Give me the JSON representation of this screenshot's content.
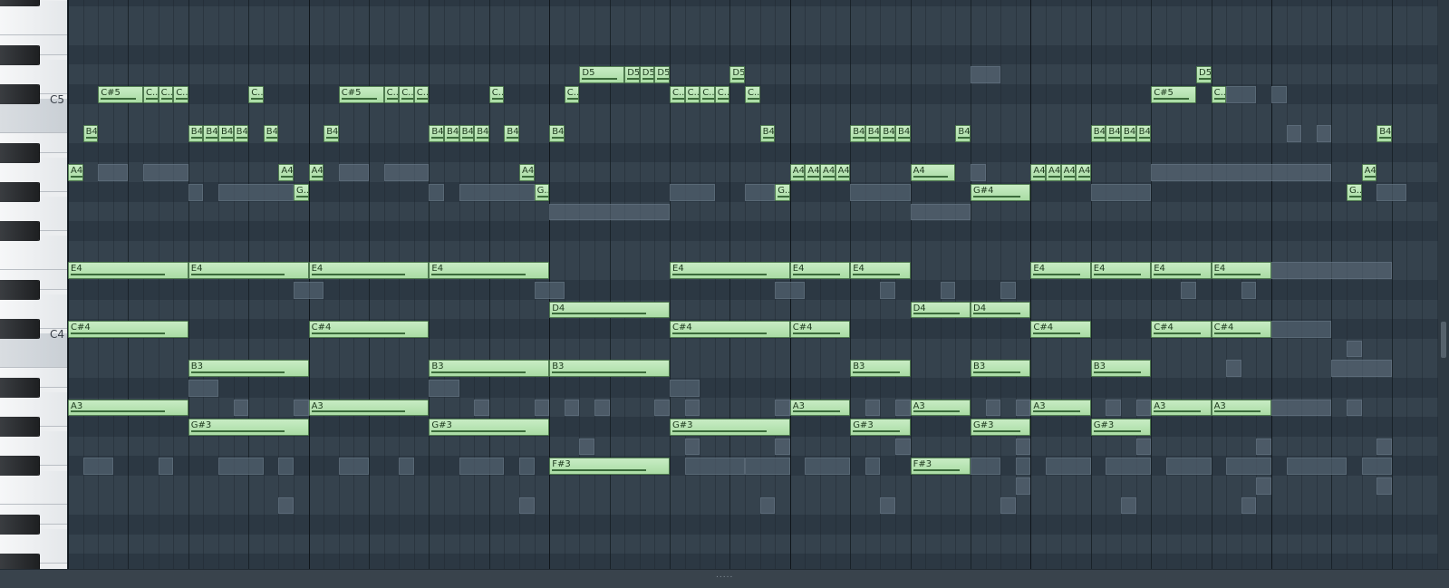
{
  "keyboard": {
    "c5_label": "C5",
    "c4_label": "C4"
  },
  "roll": {
    "lowest_pitch": "F#3",
    "highest_pitch": "E5",
    "steps_visible": 92,
    "steps_per_beat": 4,
    "steps_per_bar": 16
  },
  "notes": [
    {
      "label": "A4",
      "pitch": "A4",
      "start": 0,
      "length": 1
    },
    {
      "label": "B4",
      "pitch": "B4",
      "start": 1,
      "length": 1
    },
    {
      "label": "C#5",
      "pitch": "C#5",
      "start": 2,
      "length": 3
    },
    {
      "label": "C..",
      "pitch": "C#5",
      "start": 5,
      "length": 1
    },
    {
      "label": "C..",
      "pitch": "C#5",
      "start": 6,
      "length": 1
    },
    {
      "label": "C..",
      "pitch": "C#5",
      "start": 7,
      "length": 1
    },
    {
      "label": "B4",
      "pitch": "B4",
      "start": 8,
      "length": 1
    },
    {
      "label": "B4",
      "pitch": "B4",
      "start": 9,
      "length": 1
    },
    {
      "label": "B4",
      "pitch": "B4",
      "start": 10,
      "length": 1
    },
    {
      "label": "B4",
      "pitch": "B4",
      "start": 11,
      "length": 1
    },
    {
      "label": "C..",
      "pitch": "C#5",
      "start": 12,
      "length": 1
    },
    {
      "label": "B4",
      "pitch": "B4",
      "start": 13,
      "length": 1
    },
    {
      "label": "A4",
      "pitch": "A4",
      "start": 14,
      "length": 1
    },
    {
      "label": "G..",
      "pitch": "G#4",
      "start": 15,
      "length": 1
    },
    {
      "label": "A4",
      "pitch": "A4",
      "start": 16,
      "length": 1
    },
    {
      "label": "B4",
      "pitch": "B4",
      "start": 17,
      "length": 1
    },
    {
      "label": "C#5",
      "pitch": "C#5",
      "start": 18,
      "length": 3
    },
    {
      "label": "C..",
      "pitch": "C#5",
      "start": 21,
      "length": 1
    },
    {
      "label": "C..",
      "pitch": "C#5",
      "start": 22,
      "length": 1
    },
    {
      "label": "C..",
      "pitch": "C#5",
      "start": 23,
      "length": 1
    },
    {
      "label": "B4",
      "pitch": "B4",
      "start": 24,
      "length": 1
    },
    {
      "label": "B4",
      "pitch": "B4",
      "start": 25,
      "length": 1
    },
    {
      "label": "B4",
      "pitch": "B4",
      "start": 26,
      "length": 1
    },
    {
      "label": "B4",
      "pitch": "B4",
      "start": 27,
      "length": 1
    },
    {
      "label": "C..",
      "pitch": "C#5",
      "start": 28,
      "length": 1
    },
    {
      "label": "B4",
      "pitch": "B4",
      "start": 29,
      "length": 1
    },
    {
      "label": "A4",
      "pitch": "A4",
      "start": 30,
      "length": 1
    },
    {
      "label": "G..",
      "pitch": "G#4",
      "start": 31,
      "length": 1
    },
    {
      "label": "B4",
      "pitch": "B4",
      "start": 32,
      "length": 1
    },
    {
      "label": "C..",
      "pitch": "C#5",
      "start": 33,
      "length": 1
    },
    {
      "label": "D5",
      "pitch": "D5",
      "start": 34,
      "length": 3
    },
    {
      "label": "D5",
      "pitch": "D5",
      "start": 37,
      "length": 1
    },
    {
      "label": "D5",
      "pitch": "D5",
      "start": 38,
      "length": 1
    },
    {
      "label": "D5",
      "pitch": "D5",
      "start": 39,
      "length": 1
    },
    {
      "label": "C..",
      "pitch": "C#5",
      "start": 40,
      "length": 1
    },
    {
      "label": "C..",
      "pitch": "C#5",
      "start": 41,
      "length": 1
    },
    {
      "label": "C..",
      "pitch": "C#5",
      "start": 42,
      "length": 1
    },
    {
      "label": "C..",
      "pitch": "C#5",
      "start": 43,
      "length": 1
    },
    {
      "label": "D5",
      "pitch": "D5",
      "start": 44,
      "length": 1
    },
    {
      "label": "C..",
      "pitch": "C#5",
      "start": 45,
      "length": 1
    },
    {
      "label": "B4",
      "pitch": "B4",
      "start": 46,
      "length": 1
    },
    {
      "label": "G..",
      "pitch": "G#4",
      "start": 47,
      "length": 1
    },
    {
      "label": "A4",
      "pitch": "A4",
      "start": 48,
      "length": 1
    },
    {
      "label": "A4",
      "pitch": "A4",
      "start": 49,
      "length": 1
    },
    {
      "label": "A4",
      "pitch": "A4",
      "start": 50,
      "length": 1
    },
    {
      "label": "A4",
      "pitch": "A4",
      "start": 51,
      "length": 1
    },
    {
      "label": "B4",
      "pitch": "B4",
      "start": 52,
      "length": 1
    },
    {
      "label": "B4",
      "pitch": "B4",
      "start": 53,
      "length": 1
    },
    {
      "label": "B4",
      "pitch": "B4",
      "start": 54,
      "length": 1
    },
    {
      "label": "B4",
      "pitch": "B4",
      "start": 55,
      "length": 1
    },
    {
      "label": "A4",
      "pitch": "A4",
      "start": 56,
      "length": 3
    },
    {
      "label": "B4",
      "pitch": "B4",
      "start": 59,
      "length": 1
    },
    {
      "label": "G#4",
      "pitch": "G#4",
      "start": 60,
      "length": 4
    },
    {
      "label": "A4",
      "pitch": "A4",
      "start": 64,
      "length": 1
    },
    {
      "label": "A4",
      "pitch": "A4",
      "start": 65,
      "length": 1
    },
    {
      "label": "A4",
      "pitch": "A4",
      "start": 66,
      "length": 1
    },
    {
      "label": "A4",
      "pitch": "A4",
      "start": 67,
      "length": 1
    },
    {
      "label": "B4",
      "pitch": "B4",
      "start": 68,
      "length": 1
    },
    {
      "label": "B4",
      "pitch": "B4",
      "start": 69,
      "length": 1
    },
    {
      "label": "B4",
      "pitch": "B4",
      "start": 70,
      "length": 1
    },
    {
      "label": "B4",
      "pitch": "B4",
      "start": 71,
      "length": 1
    },
    {
      "label": "C#5",
      "pitch": "C#5",
      "start": 72,
      "length": 3
    },
    {
      "label": "D5",
      "pitch": "D5",
      "start": 75,
      "length": 1
    },
    {
      "label": "C..",
      "pitch": "C#5",
      "start": 76,
      "length": 1
    },
    {
      "label": "A4",
      "pitch": "A4",
      "start": 86,
      "length": 1
    },
    {
      "label": "G..",
      "pitch": "G#4",
      "start": 85,
      "length": 1
    },
    {
      "label": "B4",
      "pitch": "B4",
      "start": 87,
      "length": 1
    },
    {
      "label": "E4",
      "pitch": "E4",
      "start": 0,
      "length": 8
    },
    {
      "label": "E4",
      "pitch": "E4",
      "start": 8,
      "length": 8
    },
    {
      "label": "E4",
      "pitch": "E4",
      "start": 16,
      "length": 8
    },
    {
      "label": "E4",
      "pitch": "E4",
      "start": 24,
      "length": 8
    },
    {
      "label": "E4",
      "pitch": "E4",
      "start": 40,
      "length": 8
    },
    {
      "label": "E4",
      "pitch": "E4",
      "start": 48,
      "length": 4
    },
    {
      "label": "E4",
      "pitch": "E4",
      "start": 52,
      "length": 4
    },
    {
      "label": "E4",
      "pitch": "E4",
      "start": 64,
      "length": 4
    },
    {
      "label": "E4",
      "pitch": "E4",
      "start": 68,
      "length": 4
    },
    {
      "label": "E4",
      "pitch": "E4",
      "start": 72,
      "length": 4
    },
    {
      "label": "E4",
      "pitch": "E4",
      "start": 76,
      "length": 4
    },
    {
      "label": "D4",
      "pitch": "D4",
      "start": 32,
      "length": 8
    },
    {
      "label": "D4",
      "pitch": "D4",
      "start": 56,
      "length": 4
    },
    {
      "label": "D4",
      "pitch": "D4",
      "start": 60,
      "length": 4
    },
    {
      "label": "C#4",
      "pitch": "C#4",
      "start": 0,
      "length": 8
    },
    {
      "label": "C#4",
      "pitch": "C#4",
      "start": 16,
      "length": 8
    },
    {
      "label": "C#4",
      "pitch": "C#4",
      "start": 40,
      "length": 8
    },
    {
      "label": "C#4",
      "pitch": "C#4",
      "start": 48,
      "length": 4
    },
    {
      "label": "C#4",
      "pitch": "C#4",
      "start": 64,
      "length": 4
    },
    {
      "label": "C#4",
      "pitch": "C#4",
      "start": 72,
      "length": 4
    },
    {
      "label": "C#4",
      "pitch": "C#4",
      "start": 76,
      "length": 4
    },
    {
      "label": "B3",
      "pitch": "B3",
      "start": 8,
      "length": 8
    },
    {
      "label": "B3",
      "pitch": "B3",
      "start": 24,
      "length": 8
    },
    {
      "label": "B3",
      "pitch": "B3",
      "start": 32,
      "length": 8
    },
    {
      "label": "B3",
      "pitch": "B3",
      "start": 52,
      "length": 4
    },
    {
      "label": "B3",
      "pitch": "B3",
      "start": 60,
      "length": 4
    },
    {
      "label": "B3",
      "pitch": "B3",
      "start": 68,
      "length": 4
    },
    {
      "label": "A3",
      "pitch": "A3",
      "start": 0,
      "length": 8
    },
    {
      "label": "A3",
      "pitch": "A3",
      "start": 16,
      "length": 8
    },
    {
      "label": "A3",
      "pitch": "A3",
      "start": 48,
      "length": 4
    },
    {
      "label": "A3",
      "pitch": "A3",
      "start": 56,
      "length": 4
    },
    {
      "label": "A3",
      "pitch": "A3",
      "start": 64,
      "length": 4
    },
    {
      "label": "A3",
      "pitch": "A3",
      "start": 72,
      "length": 4
    },
    {
      "label": "A3",
      "pitch": "A3",
      "start": 76,
      "length": 4
    },
    {
      "label": "G#3",
      "pitch": "G#3",
      "start": 8,
      "length": 8
    },
    {
      "label": "G#3",
      "pitch": "G#3",
      "start": 24,
      "length": 8
    },
    {
      "label": "G#3",
      "pitch": "G#3",
      "start": 40,
      "length": 8
    },
    {
      "label": "G#3",
      "pitch": "G#3",
      "start": 52,
      "length": 4
    },
    {
      "label": "G#3",
      "pitch": "G#3",
      "start": 60,
      "length": 4
    },
    {
      "label": "G#3",
      "pitch": "G#3",
      "start": 68,
      "length": 4
    },
    {
      "label": "F#3",
      "pitch": "F#3",
      "start": 32,
      "length": 8
    },
    {
      "label": "F#3",
      "pitch": "F#3",
      "start": 56,
      "length": 4
    }
  ],
  "ghost_notes": [
    {
      "pitch": "A4",
      "start": 2,
      "length": 2
    },
    {
      "pitch": "A4",
      "start": 5,
      "length": 3
    },
    {
      "pitch": "A4",
      "start": 18,
      "length": 2
    },
    {
      "pitch": "A4",
      "start": 21,
      "length": 3
    },
    {
      "pitch": "G#4",
      "start": 8,
      "length": 1
    },
    {
      "pitch": "G#4",
      "start": 10,
      "length": 5
    },
    {
      "pitch": "G#4",
      "start": 24,
      "length": 1
    },
    {
      "pitch": "G#4",
      "start": 26,
      "length": 5
    },
    {
      "pitch": "G#4",
      "start": 40,
      "length": 3
    },
    {
      "pitch": "G#4",
      "start": 45,
      "length": 2
    },
    {
      "pitch": "G#4",
      "start": 52,
      "length": 4
    },
    {
      "pitch": "G#4",
      "start": 68,
      "length": 4
    },
    {
      "pitch": "G4",
      "start": 32,
      "length": 8
    },
    {
      "pitch": "G4",
      "start": 56,
      "length": 4
    },
    {
      "pitch": "D5",
      "start": 60,
      "length": 2
    },
    {
      "pitch": "C#5",
      "start": 77,
      "length": 2
    },
    {
      "pitch": "C#5",
      "start": 80,
      "length": 1
    },
    {
      "pitch": "B4",
      "start": 81,
      "length": 1
    },
    {
      "pitch": "B4",
      "start": 83,
      "length": 1
    },
    {
      "pitch": "A4",
      "start": 72,
      "length": 12
    },
    {
      "pitch": "A4",
      "start": 60,
      "length": 1
    },
    {
      "pitch": "G#4",
      "start": 87,
      "length": 2
    },
    {
      "pitch": "E4",
      "start": 80,
      "length": 8
    },
    {
      "pitch": "D#4",
      "start": 15,
      "length": 2
    },
    {
      "pitch": "D#4",
      "start": 31,
      "length": 2
    },
    {
      "pitch": "D#4",
      "start": 47,
      "length": 2
    },
    {
      "pitch": "D#4",
      "start": 54,
      "length": 1
    },
    {
      "pitch": "D#4",
      "start": 58,
      "length": 1
    },
    {
      "pitch": "D#4",
      "start": 62,
      "length": 1
    },
    {
      "pitch": "D#4",
      "start": 74,
      "length": 1
    },
    {
      "pitch": "D#4",
      "start": 78,
      "length": 1
    },
    {
      "pitch": "C#4",
      "start": 80,
      "length": 4
    },
    {
      "pitch": "C4",
      "start": 85,
      "length": 1
    },
    {
      "pitch": "B3",
      "start": 84,
      "length": 4
    },
    {
      "pitch": "B3",
      "start": 77,
      "length": 1
    },
    {
      "pitch": "A#3",
      "start": 8,
      "length": 2
    },
    {
      "pitch": "A#3",
      "start": 24,
      "length": 2
    },
    {
      "pitch": "A#3",
      "start": 40,
      "length": 2
    },
    {
      "pitch": "A3",
      "start": 11,
      "length": 1
    },
    {
      "pitch": "A3",
      "start": 15,
      "length": 1
    },
    {
      "pitch": "A3",
      "start": 27,
      "length": 1
    },
    {
      "pitch": "A3",
      "start": 31,
      "length": 1
    },
    {
      "pitch": "A3",
      "start": 33,
      "length": 1
    },
    {
      "pitch": "A3",
      "start": 35,
      "length": 1
    },
    {
      "pitch": "A3",
      "start": 39,
      "length": 1
    },
    {
      "pitch": "A3",
      "start": 41,
      "length": 1
    },
    {
      "pitch": "A3",
      "start": 47,
      "length": 1
    },
    {
      "pitch": "A3",
      "start": 53,
      "length": 1
    },
    {
      "pitch": "A3",
      "start": 55,
      "length": 1
    },
    {
      "pitch": "A3",
      "start": 61,
      "length": 1
    },
    {
      "pitch": "A3",
      "start": 63,
      "length": 1
    },
    {
      "pitch": "A3",
      "start": 69,
      "length": 1
    },
    {
      "pitch": "A3",
      "start": 71,
      "length": 1
    },
    {
      "pitch": "A3",
      "start": 80,
      "length": 4
    },
    {
      "pitch": "A3",
      "start": 85,
      "length": 1
    },
    {
      "pitch": "G3",
      "start": 34,
      "length": 1
    },
    {
      "pitch": "G3",
      "start": 41,
      "length": 1
    },
    {
      "pitch": "G3",
      "start": 47,
      "length": 1
    },
    {
      "pitch": "G3",
      "start": 55,
      "length": 1
    },
    {
      "pitch": "G3",
      "start": 63,
      "length": 1
    },
    {
      "pitch": "G3",
      "start": 71,
      "length": 1
    },
    {
      "pitch": "G3",
      "start": 79,
      "length": 1
    },
    {
      "pitch": "G3",
      "start": 87,
      "length": 1
    },
    {
      "pitch": "F#3",
      "start": 1,
      "length": 2
    },
    {
      "pitch": "F#3",
      "start": 6,
      "length": 1
    },
    {
      "pitch": "F#3",
      "start": 10,
      "length": 3
    },
    {
      "pitch": "F#3",
      "start": 14,
      "length": 1
    },
    {
      "pitch": "F#3",
      "start": 18,
      "length": 2
    },
    {
      "pitch": "F#3",
      "start": 22,
      "length": 1
    },
    {
      "pitch": "F#3",
      "start": 26,
      "length": 3
    },
    {
      "pitch": "F#3",
      "start": 30,
      "length": 1
    },
    {
      "pitch": "F#3",
      "start": 41,
      "length": 4
    },
    {
      "pitch": "F#3",
      "start": 45,
      "length": 3
    },
    {
      "pitch": "F#3",
      "start": 49,
      "length": 3
    },
    {
      "pitch": "F#3",
      "start": 53,
      "length": 1
    },
    {
      "pitch": "F#3",
      "start": 60,
      "length": 2
    },
    {
      "pitch": "F#3",
      "start": 63,
      "length": 1
    },
    {
      "pitch": "F#3",
      "start": 65,
      "length": 3
    },
    {
      "pitch": "F#3",
      "start": 69,
      "length": 3
    },
    {
      "pitch": "F#3",
      "start": 73,
      "length": 3
    },
    {
      "pitch": "F#3",
      "start": 77,
      "length": 3
    },
    {
      "pitch": "F#3",
      "start": 81,
      "length": 4
    },
    {
      "pitch": "F#3",
      "start": 86,
      "length": 2
    },
    {
      "pitch": "F3",
      "start": 63,
      "length": 1
    },
    {
      "pitch": "F3",
      "start": 79,
      "length": 1
    },
    {
      "pitch": "F3",
      "start": 87,
      "length": 1
    },
    {
      "pitch": "E3",
      "start": 14,
      "length": 1
    },
    {
      "pitch": "E3",
      "start": 30,
      "length": 1
    },
    {
      "pitch": "E3",
      "start": 46,
      "length": 1
    },
    {
      "pitch": "E3",
      "start": 54,
      "length": 1
    },
    {
      "pitch": "E3",
      "start": 62,
      "length": 1
    },
    {
      "pitch": "E3",
      "start": 70,
      "length": 1
    },
    {
      "pitch": "E3",
      "start": 78,
      "length": 1
    }
  ],
  "bottom_bar": {
    "handle": "....."
  }
}
